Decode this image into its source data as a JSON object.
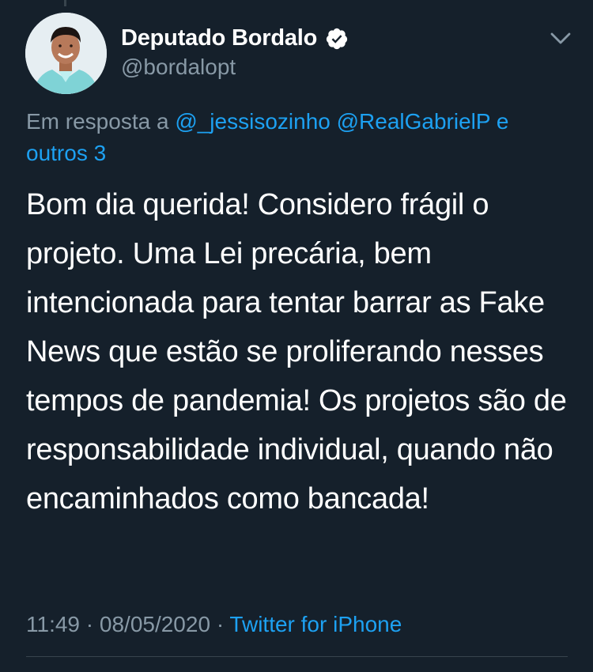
{
  "tweet": {
    "author": {
      "display_name": "Deputado Bordalo",
      "handle": "@bordalopt",
      "verified": true,
      "avatar_icon": "avatar-photo"
    },
    "reply": {
      "prefix": "Em resposta a",
      "mention_1": "@_jessisozinho",
      "mention_2": "@RealGabrielP",
      "connector": "e",
      "others": "outros 3"
    },
    "text": "Bom dia querida! Considero frágil o projeto. Uma Lei precária, bem intencionada para tentar barrar as Fake News que estão se proliferando nesses tempos de pandemia! Os projetos são de responsabilidade individual, quando não encaminhados como bancada!",
    "time": "11:49",
    "separator": "·",
    "date": "08/05/2020",
    "source": "Twitter for iPhone"
  },
  "colors": {
    "background": "#15202b",
    "text": "#ffffff",
    "muted": "#8899a6",
    "accent": "#1da1f2",
    "divider": "#38444d"
  },
  "icons": {
    "verified": "verified-badge-icon",
    "menu": "chevron-down-icon"
  }
}
